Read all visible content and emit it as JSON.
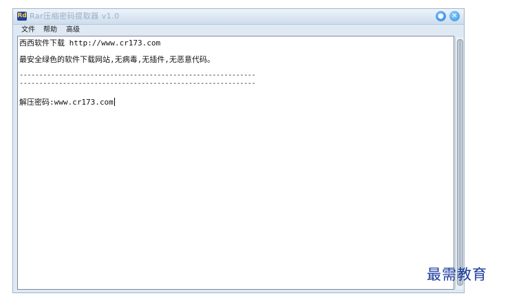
{
  "window": {
    "title": "Rar压缩密码提取器 v1.0",
    "icon_label": "Rd"
  },
  "menu": {
    "file": "文件",
    "help": "帮助",
    "advanced": "高级"
  },
  "editor": {
    "lines": [
      "西西软件下载 http://www.cr173.com",
      "最安全绿色的软件下载网站,无病毒,无插件,无恶意代码。",
      "------------------------------------------------------------",
      "------------------------------------------------------------",
      "解压密码:www.cr173.com"
    ]
  },
  "watermark": "最需教育",
  "colors": {
    "window_bg": "#dfe9f4",
    "title_text": "#9aaec4",
    "watermark": "#1b3a9c"
  },
  "icons": {
    "skin": "shirt-icon",
    "close": "close-icon"
  }
}
